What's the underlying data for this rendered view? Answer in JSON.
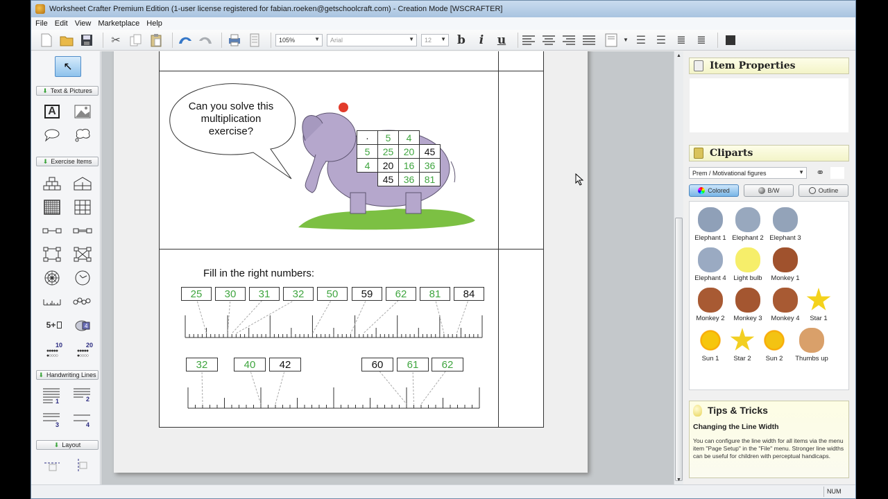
{
  "window": {
    "title": "Worksheet Crafter Premium Edition (1-user license registered for fabian.roeken@getschoolcraft.com) - Creation Mode [WSCRAFTER]"
  },
  "menu": [
    "File",
    "Edit",
    "View",
    "Marketplace",
    "Help"
  ],
  "toolbar": {
    "zoom_value": "105%",
    "font_value": "Arial",
    "size_value": "12",
    "bold_label": "b",
    "italic_label": "i",
    "underline_label": "u"
  },
  "tools": {
    "groups": {
      "text_pictures": "Text & Pictures",
      "exercise_items": "Exercise Items",
      "handwriting_lines": "Handwriting Lines",
      "layout": "Layout"
    },
    "dots_10": "10",
    "dots_20": "20",
    "sum_label": "5+",
    "lines": [
      "1",
      "2",
      "3",
      "4"
    ]
  },
  "worksheet": {
    "speech_bubble": [
      "Can you solve this",
      "multiplication",
      "exercise?"
    ],
    "mult_table": [
      [
        {
          "v": "·",
          "c": "blk"
        },
        {
          "v": "5",
          "c": "green"
        },
        {
          "v": "4",
          "c": "green"
        },
        null
      ],
      [
        {
          "v": "5",
          "c": "green"
        },
        {
          "v": "25",
          "c": "green"
        },
        {
          "v": "20",
          "c": "green"
        },
        {
          "v": "45",
          "c": "blk"
        }
      ],
      [
        {
          "v": "4",
          "c": "green"
        },
        {
          "v": "20",
          "c": "blk"
        },
        {
          "v": "16",
          "c": "green"
        },
        {
          "v": "36",
          "c": "green"
        }
      ],
      [
        null,
        {
          "v": "45",
          "c": "blk"
        },
        {
          "v": "36",
          "c": "green"
        },
        {
          "v": "81",
          "c": "green"
        }
      ]
    ],
    "fill_title": "Fill in the right numbers:",
    "ruler1": {
      "boxes": [
        {
          "v": "25",
          "c": "green"
        },
        {
          "v": "30",
          "c": "green"
        },
        {
          "v": "31",
          "c": "green"
        },
        {
          "v": "32",
          "c": "green"
        },
        {
          "v": "50",
          "c": "green"
        },
        {
          "v": "59",
          "c": "blk"
        },
        {
          "v": "62",
          "c": "green"
        },
        {
          "v": "81",
          "c": "green"
        },
        {
          "v": "84",
          "c": "blk"
        }
      ]
    },
    "ruler2": {
      "boxes": [
        {
          "v": "32",
          "c": "green"
        },
        {
          "v": "40",
          "c": "green"
        },
        {
          "v": "42",
          "c": "blk"
        },
        {
          "v": "60",
          "c": "blk"
        },
        {
          "v": "61",
          "c": "green"
        },
        {
          "v": "62",
          "c": "green"
        }
      ]
    }
  },
  "right_panel": {
    "item_properties_title": "Item Properties",
    "cliparts_title": "Cliparts",
    "category_value": "Prem / Motivational figures",
    "modes": [
      "Colored",
      "B/W",
      "Outline"
    ],
    "cliparts": [
      {
        "label": "Elephant 1",
        "color": "#8fa0b8"
      },
      {
        "label": "Elephant 2",
        "color": "#98a8be"
      },
      {
        "label": "Elephant 3",
        "color": "#93a3b9"
      },
      {
        "label": "Elephant 4",
        "color": "#9aaac2"
      },
      {
        "label": "Light bulb",
        "color": "#f6ee6a"
      },
      {
        "label": "Monkey 1",
        "color": "#a0522d"
      },
      {
        "label": "Monkey 2",
        "color": "#a85a33"
      },
      {
        "label": "Monkey 3",
        "color": "#a45630"
      },
      {
        "label": "Monkey 4",
        "color": "#a85a33"
      },
      {
        "label": "Star 1",
        "color": "#f4d21c"
      },
      {
        "label": "Sun 1",
        "color": "#f6c60d"
      },
      {
        "label": "Star 2",
        "color": "#f2cf22"
      },
      {
        "label": "Sun 2",
        "color": "#f3c313"
      },
      {
        "label": "Thumbs up",
        "color": "#d9a06a"
      }
    ],
    "tips_title": "Tips & Tricks",
    "tips_heading": "Changing the Line Width",
    "tips_text": "You can configure the line width for all items via the menu item \"Page Setup\" in the \"File\" menu. Stronger line widths can be useful for children with perceptual handicaps."
  },
  "status": {
    "num": "NUM"
  }
}
